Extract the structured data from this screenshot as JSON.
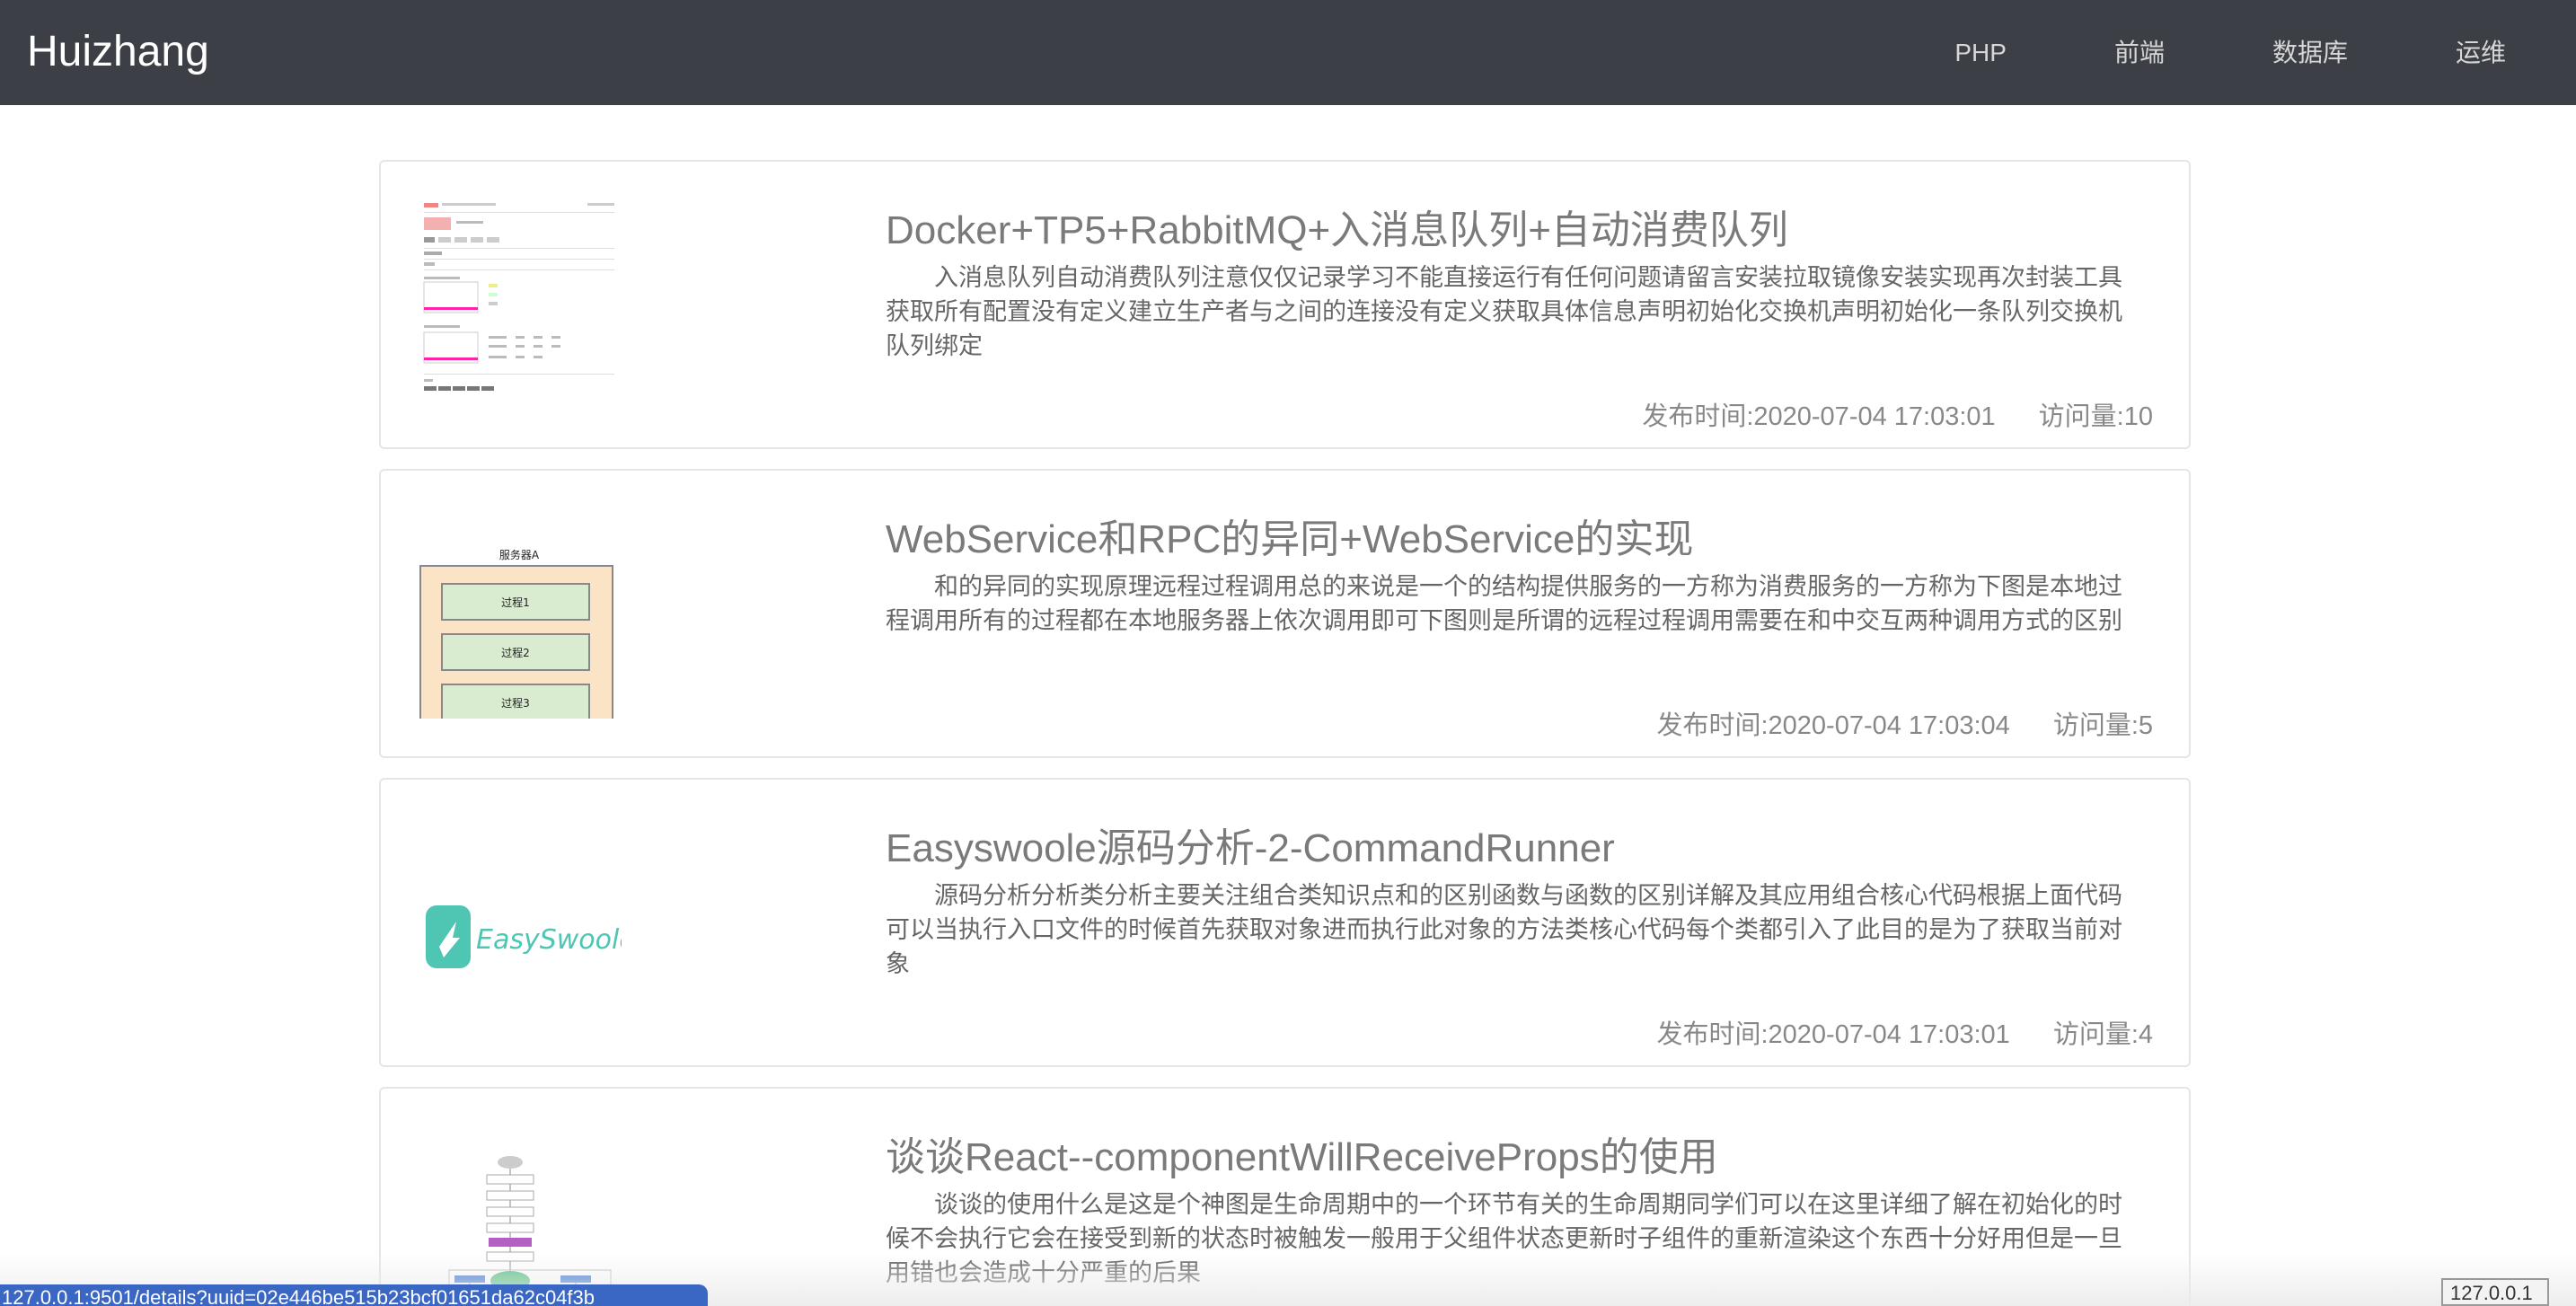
{
  "header": {
    "brand": "Huizhang",
    "nav": [
      "PHP",
      "前端",
      "数据库",
      "运维"
    ]
  },
  "articles": [
    {
      "title": "Docker+TP5+RabbitMQ+入消息队列+自动消费队列",
      "summary": "入消息队列自动消费队列注意仅仅记录学习不能直接运行有任何问题请留言安装拉取镜像安装实现再次封装工具获取所有配置没有定义建立生产者与之间的连接没有定义获取具体信息声明初始化交换机声明初始化一条队列交换机队列绑定",
      "published": "发布时间:2020-07-04 17:03:01",
      "views": "访问量:10"
    },
    {
      "title": "WebService和RPC的异同+WebService的实现",
      "summary": "和的异同的实现原理远程过程调用总的来说是一个的结构提供服务的一方称为消费服务的一方称为下图是本地过程调用所有的过程都在本地服务器上依次调用即可下图则是所谓的远程过程调用需要在和中交互两种调用方式的区别",
      "published": "发布时间:2020-07-04 17:03:04",
      "views": "访问量:5",
      "diagram": {
        "header": "服务器A",
        "boxes": [
          "过程1",
          "过程2",
          "过程3"
        ]
      }
    },
    {
      "title": "Easyswoole源码分析-2-CommandRunner",
      "summary": "源码分析分析类分析主要关注组合类知识点和的区别函数与函数的区别详解及其应用组合核心代码根据上面代码可以当执行入口文件的时候首先获取对象进而执行此对象的方法类核心代码每个类都引入了此目的是为了获取当前对象",
      "published": "发布时间:2020-07-04 17:03:01",
      "views": "访问量:4",
      "logo_text": "EasySwoole"
    },
    {
      "title": "谈谈React--componentWillReceiveProps的使用",
      "summary": "谈谈的使用什么是这是个神图是生命周期中的一个环节有关的生命周期同学们可以在这里详细了解在初始化的时候不会执行它会在接受到新的状态时被触发一般用于父组件状态更新时子组件的重新渲染这个东西十分好用但是一旦用错也会造成十分严重的后果",
      "published": "",
      "views": ""
    }
  ],
  "status_bar": {
    "url": "127.0.0.1:9501/details?uuid=02e446be515b23bcf01651da62c04f3b"
  },
  "corner_label": "127.0.0.1",
  "colors": {
    "navbar": "#3c3f45",
    "link_status": "#3a66c4",
    "logo_teal": "#4fc5b4",
    "diagram_fill": "#fbe3c6",
    "diagram_box": "#d9ecd0"
  }
}
